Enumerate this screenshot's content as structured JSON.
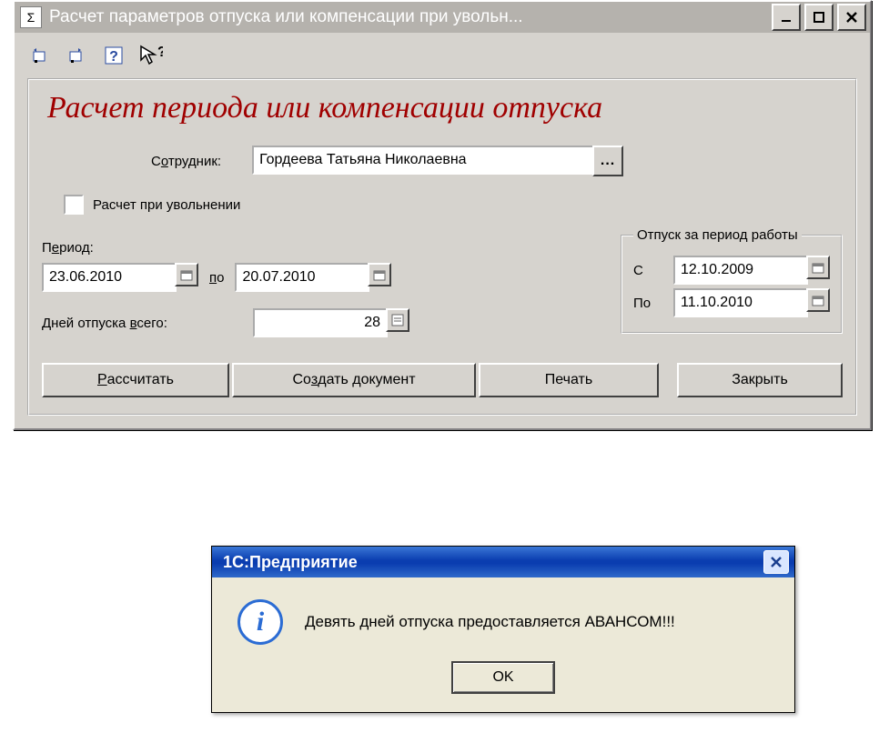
{
  "window": {
    "title": "Расчет параметров отпуска или компенсации при увольн..."
  },
  "panel": {
    "title": "Расчет периода или компенсации отпуска",
    "employee_label_pre": "С",
    "employee_label_u": "о",
    "employee_label_post": "трудник:",
    "employee_value": "Гордеева Татьяна Николаевна",
    "pick_label": "...",
    "checkbox_label": "Расчет при увольнении",
    "period_label_pre": "П",
    "period_label_u": "е",
    "period_label_post": "риод:",
    "date_from": "23.06.2010",
    "po_label_u": "п",
    "po_label_post": "о",
    "date_to": "20.07.2010",
    "days_label_pre": "Дней отпуска ",
    "days_label_u": "в",
    "days_label_post": "сего:",
    "days_value": "28",
    "work_period_legend": "Отпуск за период работы",
    "work_from_label": "С",
    "work_from": "12.10.2009",
    "work_to_label": "По",
    "work_to": "11.10.2010"
  },
  "buttons": {
    "calc_u": "Р",
    "calc_post": "ассчитать",
    "create_pre": "Со",
    "create_u": "з",
    "create_post": "дать документ",
    "print": "Печать",
    "close": "Закрыть"
  },
  "msgbox": {
    "title": "1С:Предприятие",
    "text": "Девять дней отпуска предоставляется АВАНСОМ!!!",
    "ok": "OK"
  }
}
